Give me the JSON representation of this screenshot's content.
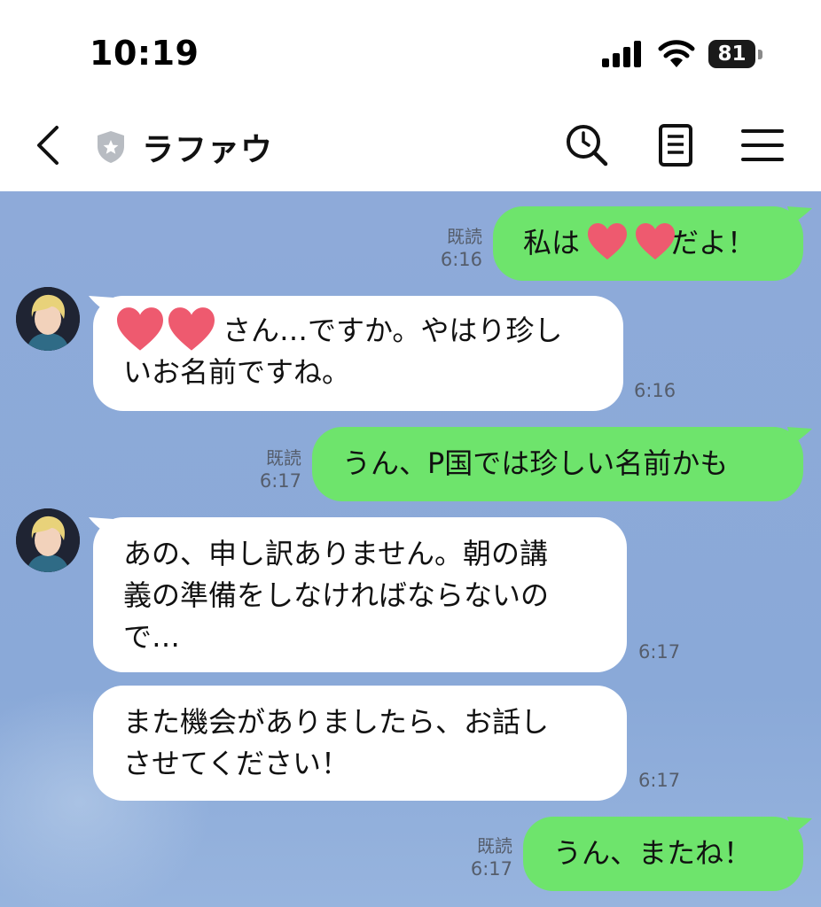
{
  "status": {
    "time": "10:19",
    "battery": "81"
  },
  "header": {
    "title": "ラファウ"
  },
  "messages": [
    {
      "side": "out",
      "text_before": "私は",
      "text_after": "だよ！",
      "read": "既読",
      "time": "6:16"
    },
    {
      "side": "in",
      "line1_rest": "さん…ですか。やはり珍し",
      "line2": "いお名前ですね。",
      "time": "6:16"
    },
    {
      "side": "out",
      "text": "うん、P国では珍しい名前かも",
      "read": "既読",
      "time": "6:17"
    },
    {
      "side": "in",
      "line1": "あの、申し訳ありません。朝の講",
      "line2": "義の準備をしなければならないの",
      "line3": "で…",
      "time": "6:17"
    },
    {
      "side": "in",
      "line1": "また機会がありましたら、お話し",
      "line2": "させてください！",
      "time": "6:17"
    },
    {
      "side": "out",
      "text": "うん、またね！",
      "read": "既読",
      "time": "6:17"
    }
  ],
  "colors": {
    "chat_bg": "#8eaad9",
    "out_bubble": "#6ee46c",
    "in_bubble": "#ffffff",
    "heart": "#ee5a6f"
  }
}
